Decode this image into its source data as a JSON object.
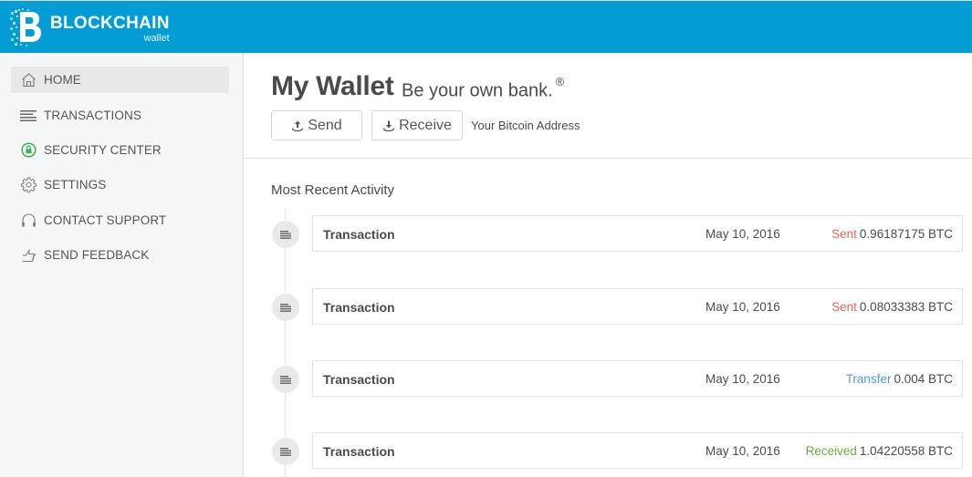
{
  "header": {
    "brand_title": "BLOCKCHAIN",
    "brand_subtitle": "wallet",
    "brand_color": "#049cd5"
  },
  "sidebar": {
    "items": [
      {
        "label": "HOME",
        "icon": "home-icon",
        "active": true
      },
      {
        "label": "TRANSACTIONS",
        "icon": "list-icon",
        "active": false
      },
      {
        "label": "SECURITY CENTER",
        "icon": "lock-icon",
        "active": false,
        "icon_color": "#37b24d"
      },
      {
        "label": "SETTINGS",
        "icon": "gear-icon",
        "active": false
      },
      {
        "label": "CONTACT SUPPORT",
        "icon": "headphones-icon",
        "active": false
      },
      {
        "label": "SEND FEEDBACK",
        "icon": "thumbs-up-icon",
        "active": false
      }
    ]
  },
  "main": {
    "title": "My Wallet",
    "tagline": "Be your own bank.",
    "tagline_mark": "®",
    "send_label": "Send",
    "receive_label": "Receive",
    "address_label": "Your Bitcoin Address",
    "activity_title": "Most Recent Activity",
    "transactions": [
      {
        "name": "Transaction",
        "date": "May 10, 2016",
        "kind": "Sent",
        "amount": "0.96187175 BTC",
        "kind_color": "#e0645f"
      },
      {
        "name": "Transaction",
        "date": "May 10, 2016",
        "kind": "Sent",
        "amount": "0.08033383 BTC",
        "kind_color": "#e0645f"
      },
      {
        "name": "Transaction",
        "date": "May 10, 2016",
        "kind": "Transfer",
        "amount": "0.004 BTC",
        "kind_color": "#4d9bd6"
      },
      {
        "name": "Transaction",
        "date": "May 10, 2016",
        "kind": "Received",
        "amount": "1.04220558 BTC",
        "kind_color": "#6aac3e"
      }
    ]
  }
}
